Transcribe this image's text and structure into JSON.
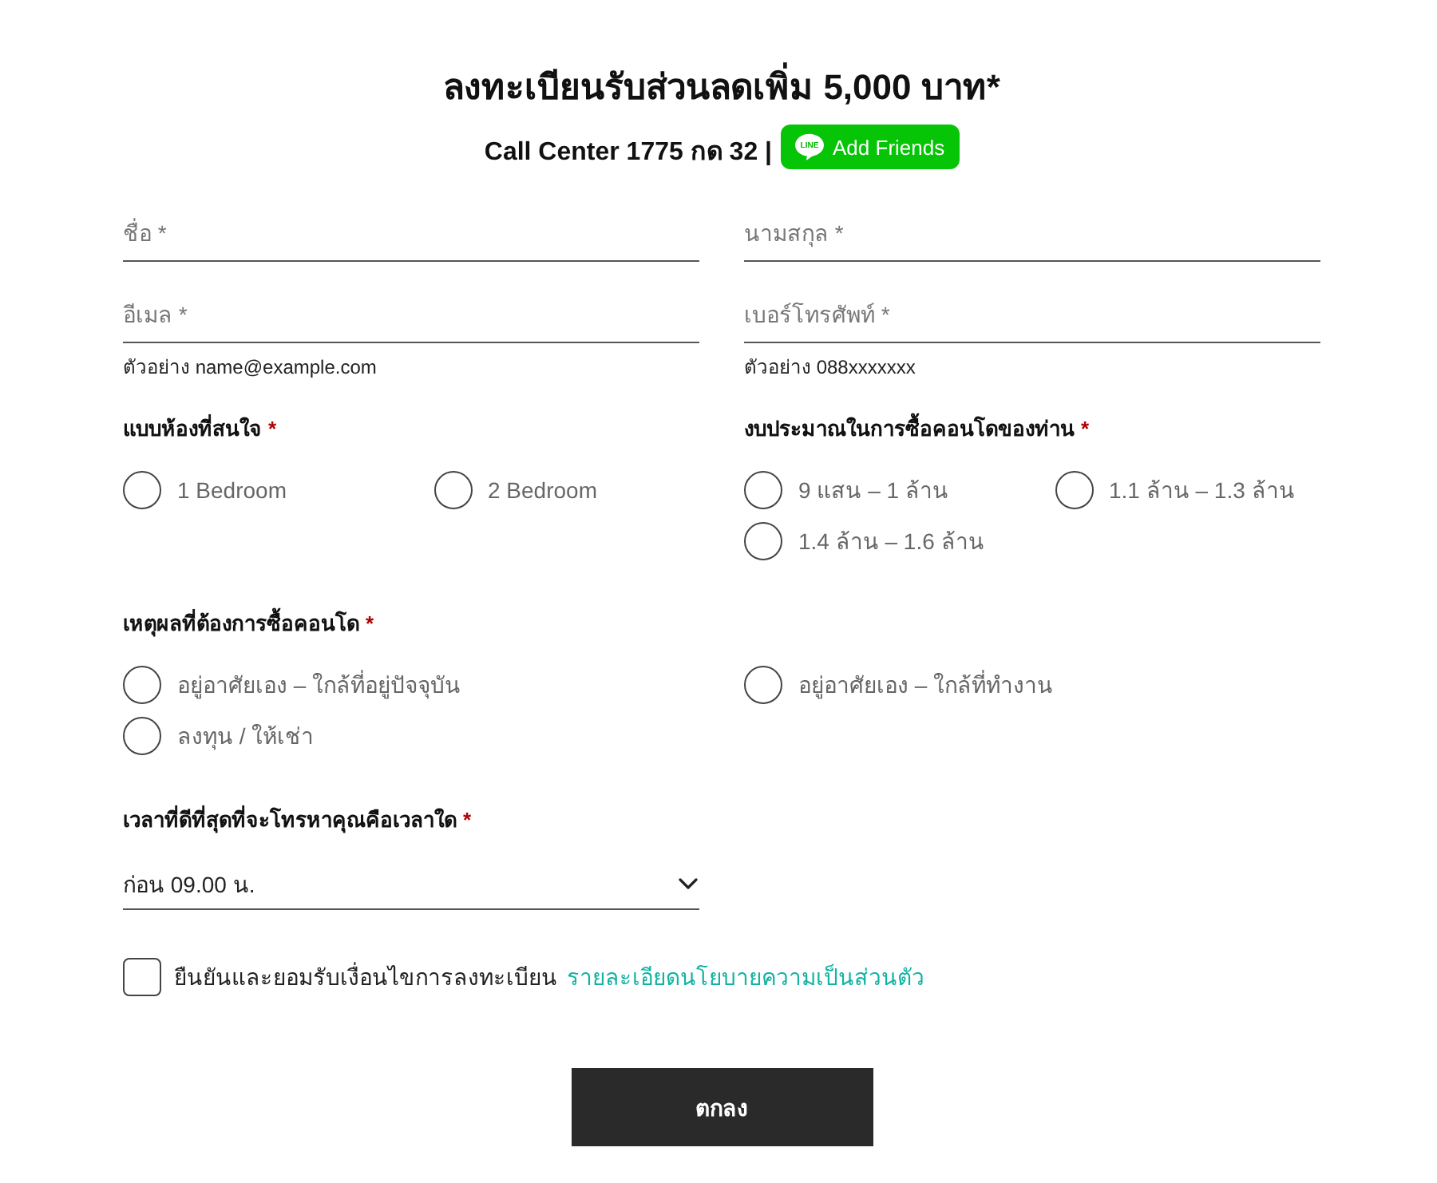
{
  "header": {
    "title": "ลงทะเบียนรับส่วนลดเพิ่ม 5,000 บาท*",
    "call_center": "Call Center 1775 กด 32 |",
    "line_button": {
      "logo_text": "LINE",
      "label": "Add Friends"
    }
  },
  "fields": [
    {
      "placeholder": "ชื่อ *"
    },
    {
      "placeholder": "นามสกุล *"
    },
    {
      "placeholder": "อีเมล *",
      "hint": "ตัวอย่าง name@example.com"
    },
    {
      "placeholder": "เบอร์โทรศัพท์ *",
      "hint": "ตัวอย่าง 088xxxxxxx"
    }
  ],
  "room_type": {
    "label": "แบบห้องที่สนใจ",
    "required_mark": "*",
    "options": [
      {
        "label": "1 Bedroom",
        "selected": false
      },
      {
        "label": "2 Bedroom",
        "selected": false
      }
    ]
  },
  "budget": {
    "label": "งบประมาณในการซื้อคอนโดของท่าน",
    "required_mark": "*",
    "options": [
      {
        "label": "9 แสน – 1 ล้าน",
        "selected": false
      },
      {
        "label": "1.1 ล้าน – 1.3 ล้าน",
        "selected": false
      },
      {
        "label": "1.4 ล้าน – 1.6 ล้าน",
        "selected": false
      }
    ]
  },
  "reason": {
    "label": "เหตุผลที่ต้องการซื้อคอนโด",
    "required_mark": "*",
    "options": [
      {
        "label": "อยู่อาศัยเอง – ใกล้ที่อยู่ปัจจุบัน",
        "selected": false
      },
      {
        "label": "อยู่อาศัยเอง – ใกล้ที่ทำงาน",
        "selected": false
      },
      {
        "label": "ลงทุน / ให้เช่า",
        "selected": false
      }
    ]
  },
  "best_time": {
    "label": "เวลาที่ดีที่สุดที่จะโทรหาคุณคือเวลาใด",
    "required_mark": "*",
    "value": "ก่อน 09.00 น."
  },
  "consent": {
    "checked": false,
    "text": "ยืนยันและยอมรับเงื่อนไขการลงทะเบียน",
    "link": "รายละเอียดนโยบายความเป็นส่วนตัว"
  },
  "submit": {
    "label": "ตกลง"
  }
}
